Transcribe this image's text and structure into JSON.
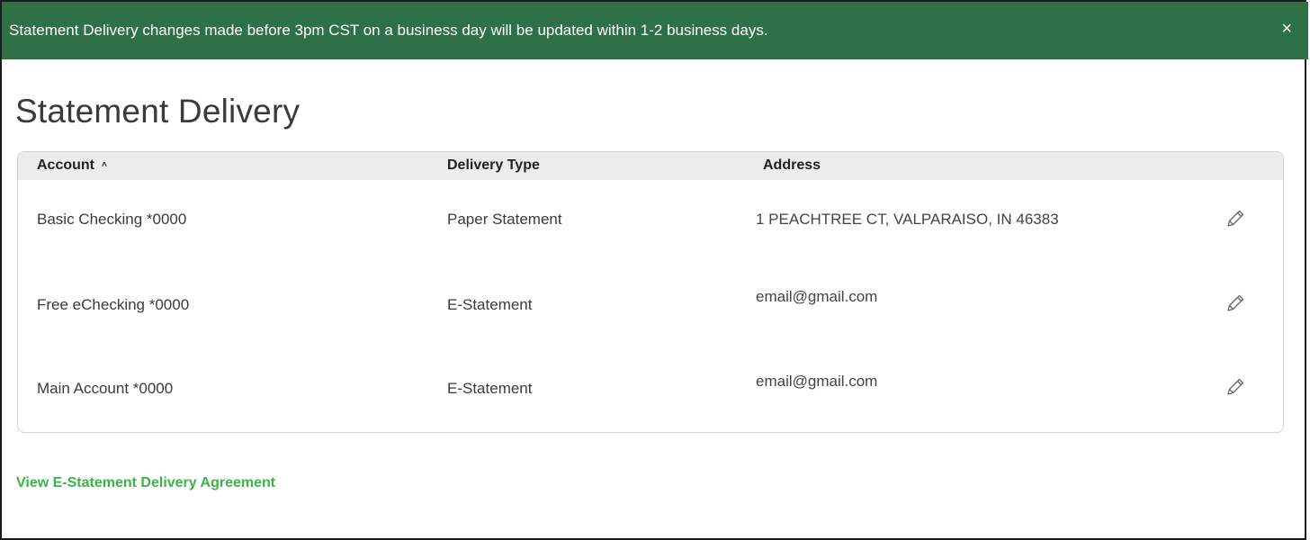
{
  "banner": {
    "message": "Statement Delivery changes made before 3pm CST on a business day will be updated within 1-2 business days.",
    "close_symbol": "×",
    "color": "#2e7048"
  },
  "page": {
    "title": "Statement Delivery"
  },
  "table": {
    "columns": {
      "account": "Account",
      "account_sort": "˄",
      "delivery_type": "Delivery Type",
      "address": "Address"
    },
    "rows": [
      {
        "account": "Basic Checking *0000",
        "delivery_type": "Paper Statement",
        "address": "1 PEACHTREE CT, VALPARAISO, IN 46383",
        "edit_icon": "pencil-icon"
      },
      {
        "account": "Free eChecking *0000",
        "delivery_type": "E-Statement",
        "address": "email@gmail.com",
        "edit_icon": "pencil-icon"
      },
      {
        "account": "Main Account *0000",
        "delivery_type": "E-Statement",
        "address": "email@gmail.com",
        "edit_icon": "pencil-icon"
      }
    ]
  },
  "footer": {
    "agreement_link": "View E-Statement Delivery Agreement",
    "link_color": "#3cb34a"
  }
}
